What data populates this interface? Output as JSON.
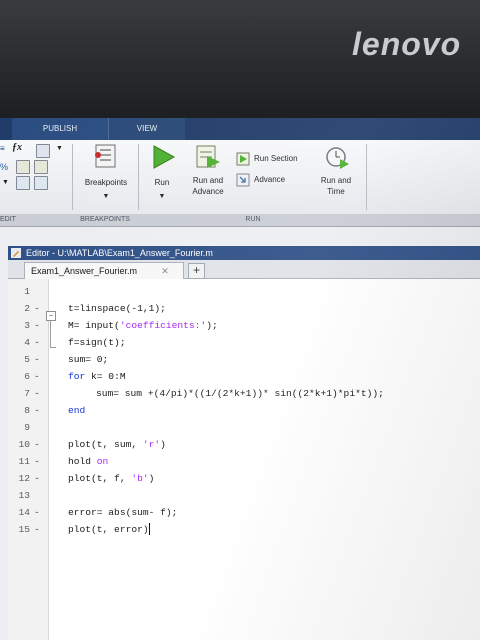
{
  "brand": "lenovo",
  "ribbon": {
    "tabs": [
      "PUBLISH",
      "VIEW"
    ],
    "buttons": {
      "breakpoints": "Breakpoints",
      "run": "Run",
      "run_and_advance": [
        "Run and",
        "Advance"
      ],
      "run_section": "Run Section",
      "advance": "Advance",
      "run_and_time": [
        "Run and",
        "Time"
      ]
    },
    "sections": [
      "EDIT",
      "BREAKPOINTS",
      "RUN"
    ],
    "accent_color": "#1f3c68"
  },
  "editor": {
    "title": "Editor - U:\\MATLAB\\Exam1_Answer_Fourier.m",
    "file_tab": "Exam1_Answer_Fourier.m",
    "close_glyph": "✕",
    "add_tab": "+",
    "lines": [
      {
        "n": "1",
        "dash": "",
        "code": ""
      },
      {
        "n": "2",
        "dash": "-",
        "code": "t=linspace(-1,1);"
      },
      {
        "n": "3",
        "dash": "-",
        "code": "M= input('coefficients:');"
      },
      {
        "n": "4",
        "dash": "-",
        "code": "f=sign(t);"
      },
      {
        "n": "5",
        "dash": "-",
        "code": "sum= 0;"
      },
      {
        "n": "6",
        "dash": "-",
        "code": "for k= 0:M"
      },
      {
        "n": "7",
        "dash": "-",
        "code": "sum= sum +(4/pi)*((1/(2*k+1))* sin((2*k+1)*pi*t));"
      },
      {
        "n": "8",
        "dash": "-",
        "code": "end"
      },
      {
        "n": "9",
        "dash": "",
        "code": ""
      },
      {
        "n": "10",
        "dash": "-",
        "code": "plot(t, sum, 'r')"
      },
      {
        "n": "11",
        "dash": "-",
        "code": "hold on"
      },
      {
        "n": "12",
        "dash": "-",
        "code": "plot(t, f, 'b')"
      },
      {
        "n": "13",
        "dash": "",
        "code": ""
      },
      {
        "n": "14",
        "dash": "-",
        "code": "error= abs(sum- f);"
      },
      {
        "n": "15",
        "dash": "-",
        "code": "plot(t, error)"
      }
    ],
    "code_segments": {
      "l3a": "M= input(",
      "l3s": "'coefficients:'",
      "l3b": ");",
      "l6k": "for",
      "l6b": " k= 0:M",
      "l8k": "end",
      "l10a": "plot(t, sum, ",
      "l10s": "'r'",
      "l10b": ")",
      "l11a": "hold ",
      "l11k": "on",
      "l12a": "plot(t, f, ",
      "l12s": "'b'",
      "l12b": ")"
    }
  }
}
